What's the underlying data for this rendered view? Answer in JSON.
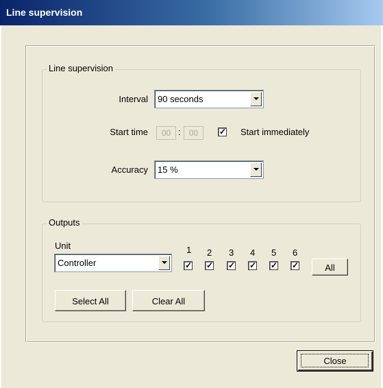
{
  "window": {
    "title": "Line supervision"
  },
  "line_supervision": {
    "group_label": "Line supervision",
    "interval_label": "Interval",
    "interval_value": "90 seconds",
    "start_time_label": "Start time",
    "start_hours": "00",
    "time_separator": ":",
    "start_minutes": "00",
    "start_immediately_label": "Start immediately",
    "start_immediately_checked": true,
    "accuracy_label": "Accuracy",
    "accuracy_value": "15 %"
  },
  "outputs": {
    "group_label": "Outputs",
    "unit_label": "Unit",
    "unit_value": "Controller",
    "channels": [
      {
        "label": "1",
        "checked": true
      },
      {
        "label": "2",
        "checked": true
      },
      {
        "label": "3",
        "checked": true
      },
      {
        "label": "4",
        "checked": true
      },
      {
        "label": "5",
        "checked": true
      },
      {
        "label": "6",
        "checked": true
      }
    ],
    "all_label": "All",
    "select_all_label": "Select All",
    "clear_all_label": "Clear All"
  },
  "footer": {
    "close_label": "Close"
  },
  "icons": {
    "check": "checkmark-icon",
    "dropdown": "chevron-down-icon"
  }
}
